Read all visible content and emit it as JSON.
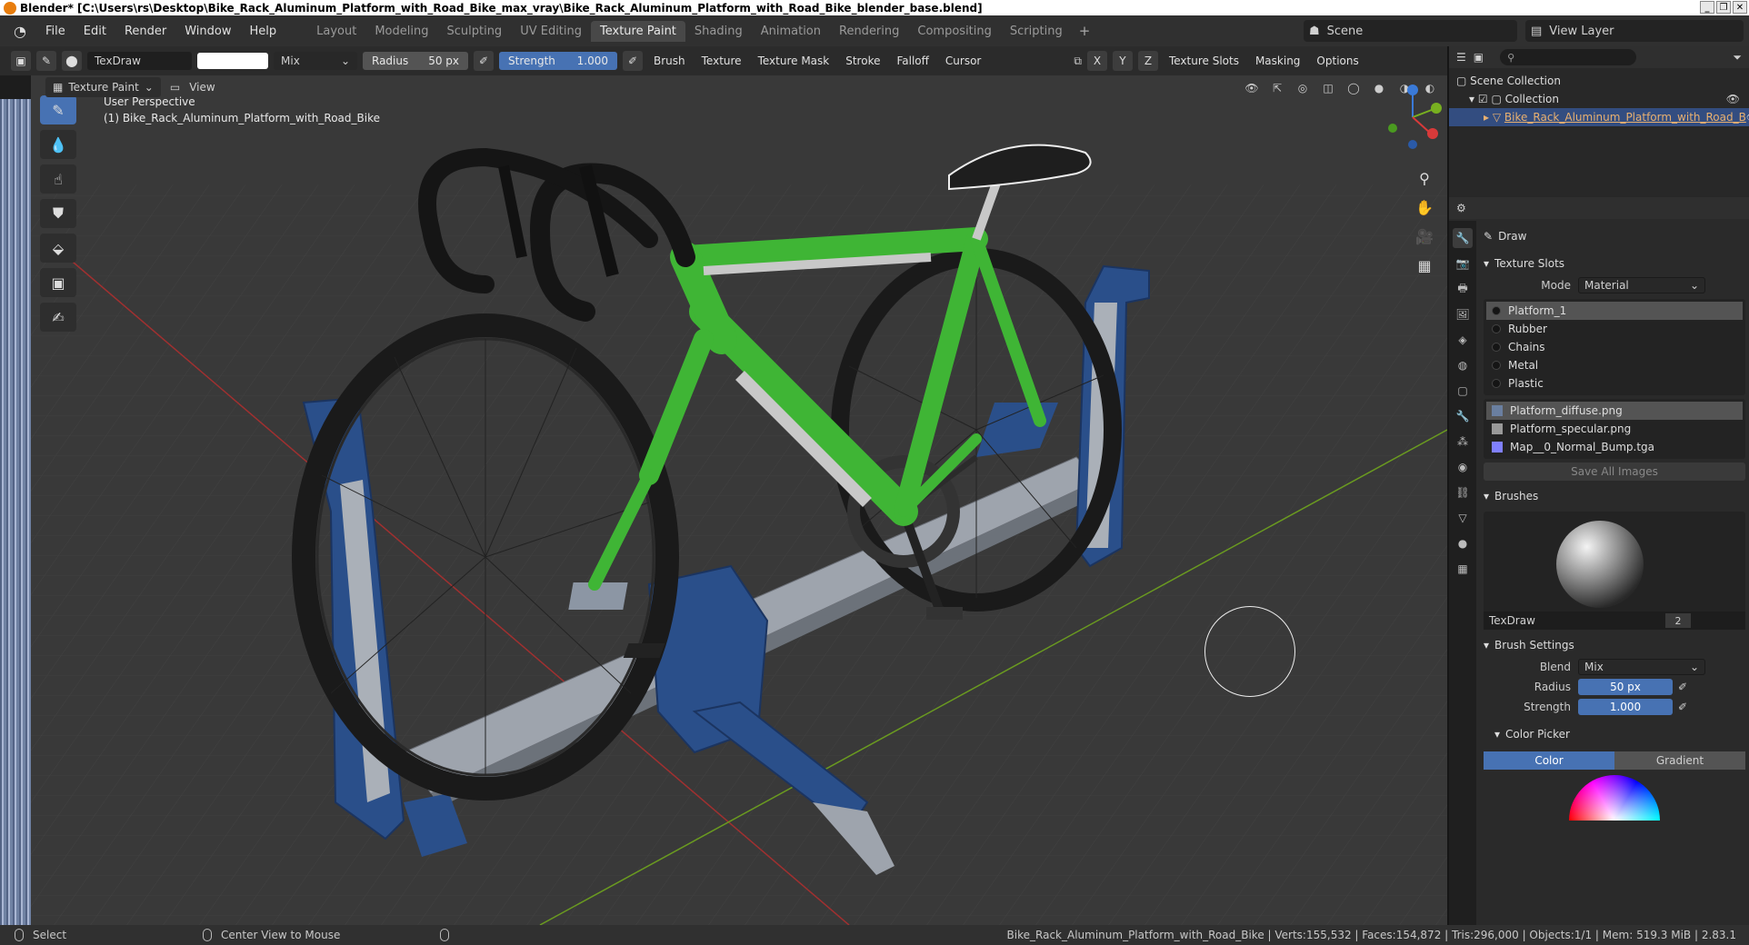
{
  "window": {
    "title": "Blender* [C:\\Users\\rs\\Desktop\\Bike_Rack_Aluminum_Platform_with_Road_Bike_max_vray\\Bike_Rack_Aluminum_Platform_with_Road_Bike_blender_base.blend]",
    "min": "_",
    "max": "❐",
    "close": "✕"
  },
  "menu": {
    "items": [
      "File",
      "Edit",
      "Render",
      "Window",
      "Help"
    ],
    "workspaces": [
      "Layout",
      "Modeling",
      "Sculpting",
      "UV Editing",
      "Texture Paint",
      "Shading",
      "Animation",
      "Rendering",
      "Compositing",
      "Scripting"
    ],
    "active_workspace": "Texture Paint",
    "add": "+",
    "scene": "Scene",
    "view_layer": "View Layer"
  },
  "tool_header": {
    "brush_name": "TexDraw",
    "blend": "Mix",
    "radius_label": "Radius",
    "radius_value": "50 px",
    "strength_label": "Strength",
    "strength_value": "1.000",
    "menus": [
      "Brush",
      "Texture",
      "Texture Mask",
      "Stroke",
      "Falloff",
      "Cursor"
    ],
    "axes": [
      "X",
      "Y",
      "Z"
    ],
    "right_menus": [
      "Texture Slots",
      "Masking",
      "Options"
    ]
  },
  "view_header": {
    "mode": "Texture Paint",
    "view": "View"
  },
  "viewport": {
    "perspective": "User Perspective",
    "object_label": "(1) Bike_Rack_Aluminum_Platform_with_Road_Bike"
  },
  "outliner": {
    "scene_collection": "Scene Collection",
    "collection": "Collection",
    "object": "Bike_Rack_Aluminum_Platform_with_Road_B"
  },
  "properties": {
    "tool": "Draw",
    "texture_slots_header": "Texture Slots",
    "mode_label": "Mode",
    "mode_value": "Material",
    "materials": [
      "Platform_1",
      "Rubber",
      "Chains",
      "Metal",
      "Plastic"
    ],
    "images": [
      "Platform_diffuse.png",
      "Platform_specular.png",
      "Map__0_Normal_Bump.tga"
    ],
    "save_all": "Save All Images",
    "brushes_header": "Brushes",
    "brush_name": "TexDraw",
    "brush_users": "2",
    "brush_settings_header": "Brush Settings",
    "blend_label": "Blend",
    "blend_value": "Mix",
    "radius_label": "Radius",
    "radius_value": "50 px",
    "strength_label": "Strength",
    "strength_value": "1.000",
    "color_picker_header": "Color Picker",
    "color_tab": "Color",
    "gradient_tab": "Gradient"
  },
  "status": {
    "select": "Select",
    "center": "Center View to Mouse",
    "info": "Bike_Rack_Aluminum_Platform_with_Road_Bike | Verts:155,532 | Faces:154,872 | Tris:296,000 | Objects:1/1 | Mem: 519.3 MiB | 2.83.1"
  },
  "colors": {
    "accent": "#4772b3",
    "bike_frame": "#3fb535",
    "rack": "#2a4f8a",
    "grid_x": "#a03030",
    "grid_y": "#6a9a20"
  }
}
